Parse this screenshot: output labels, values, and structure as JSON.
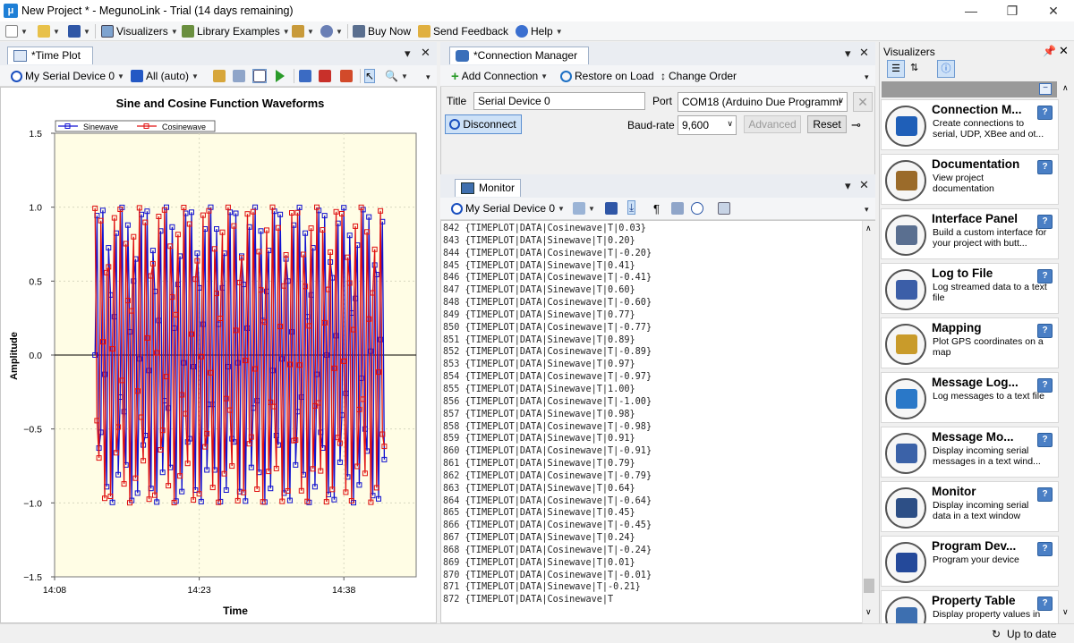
{
  "window": {
    "title": "New Project * - MegunoLink - Trial (14 days remaining)",
    "app_icon": "μ"
  },
  "toolbar": {
    "visualizers": "Visualizers",
    "library_examples": "Library Examples",
    "buy_now": "Buy Now",
    "send_feedback": "Send Feedback",
    "help": "Help"
  },
  "timeplot": {
    "tab": "*Time Plot",
    "device": "My Serial Device 0",
    "series_select": "All (auto)"
  },
  "chart_data": {
    "type": "line",
    "title": "Sine and Cosine Function Waveforms",
    "xlabel": "Time",
    "ylabel": "Amplitude",
    "ylim": [
      -1.5,
      1.5
    ],
    "yticks": [
      "1.5",
      "1.0",
      "0.5",
      "0.0",
      "−0.5",
      "−1.0",
      "−1.5"
    ],
    "ytick_values": [
      1.5,
      1.0,
      0.5,
      0.0,
      -0.5,
      -1.0,
      -1.5
    ],
    "xticks": [
      "14:08",
      "14:23",
      "14:38"
    ],
    "x_range_minutes": [
      0,
      37.5
    ],
    "xtick_minutes": [
      0,
      15,
      30
    ],
    "data_start_minute": 4.2,
    "data_end_minute": 34.2,
    "sample_step": 0.2,
    "grid": true,
    "legend_location": "top-left",
    "series": [
      {
        "name": "Sinewave",
        "color": "#1010d0",
        "function": "sin"
      },
      {
        "name": "Cosinewave",
        "color": "#e01010",
        "function": "cos"
      }
    ]
  },
  "connection": {
    "tab": "*Connection Manager",
    "add_connection": "Add Connection",
    "restore_on_load": "Restore on Load",
    "change_order": "Change Order",
    "title_label": "Title",
    "title_value": "Serial Device 0",
    "port_label": "Port",
    "port_value": "COM18 (Arduino Due Programmi",
    "disconnect": "Disconnect",
    "baud_label": "Baud-rate",
    "baud_value": "9,600",
    "advanced": "Advanced",
    "reset": "Reset"
  },
  "monitor": {
    "tab": "Monitor",
    "device": "My Serial Device 0",
    "lines": [
      [
        "842",
        "{TIMEPLOT|DATA|Cosinewave|T|0.03}"
      ],
      [
        "843",
        "{TIMEPLOT|DATA|Sinewave|T|0.20}"
      ],
      [
        "844",
        "{TIMEPLOT|DATA|Cosinewave|T|-0.20}"
      ],
      [
        "845",
        "{TIMEPLOT|DATA|Sinewave|T|0.41}"
      ],
      [
        "846",
        "{TIMEPLOT|DATA|Cosinewave|T|-0.41}"
      ],
      [
        "847",
        "{TIMEPLOT|DATA|Sinewave|T|0.60}"
      ],
      [
        "848",
        "{TIMEPLOT|DATA|Cosinewave|T|-0.60}"
      ],
      [
        "849",
        "{TIMEPLOT|DATA|Sinewave|T|0.77}"
      ],
      [
        "850",
        "{TIMEPLOT|DATA|Cosinewave|T|-0.77}"
      ],
      [
        "851",
        "{TIMEPLOT|DATA|Sinewave|T|0.89}"
      ],
      [
        "852",
        "{TIMEPLOT|DATA|Cosinewave|T|-0.89}"
      ],
      [
        "853",
        "{TIMEPLOT|DATA|Sinewave|T|0.97}"
      ],
      [
        "854",
        "{TIMEPLOT|DATA|Cosinewave|T|-0.97}"
      ],
      [
        "855",
        "{TIMEPLOT|DATA|Sinewave|T|1.00}"
      ],
      [
        "856",
        "{TIMEPLOT|DATA|Cosinewave|T|-1.00}"
      ],
      [
        "857",
        "{TIMEPLOT|DATA|Sinewave|T|0.98}"
      ],
      [
        "858",
        "{TIMEPLOT|DATA|Cosinewave|T|-0.98}"
      ],
      [
        "859",
        "{TIMEPLOT|DATA|Sinewave|T|0.91}"
      ],
      [
        "860",
        "{TIMEPLOT|DATA|Cosinewave|T|-0.91}"
      ],
      [
        "861",
        "{TIMEPLOT|DATA|Sinewave|T|0.79}"
      ],
      [
        "862",
        "{TIMEPLOT|DATA|Cosinewave|T|-0.79}"
      ],
      [
        "863",
        "{TIMEPLOT|DATA|Sinewave|T|0.64}"
      ],
      [
        "864",
        "{TIMEPLOT|DATA|Cosinewave|T|-0.64}"
      ],
      [
        "865",
        "{TIMEPLOT|DATA|Sinewave|T|0.45}"
      ],
      [
        "866",
        "{TIMEPLOT|DATA|Cosinewave|T|-0.45}"
      ],
      [
        "867",
        "{TIMEPLOT|DATA|Sinewave|T|0.24}"
      ],
      [
        "868",
        "{TIMEPLOT|DATA|Cosinewave|T|-0.24}"
      ],
      [
        "869",
        "{TIMEPLOT|DATA|Sinewave|T|0.01}"
      ],
      [
        "870",
        "{TIMEPLOT|DATA|Cosinewave|T|-0.01}"
      ],
      [
        "871",
        "{TIMEPLOT|DATA|Sinewave|T|-0.21}"
      ],
      [
        "872",
        "{TIMEPLOT|DATA|Cosinewave|T"
      ]
    ]
  },
  "visualizers": {
    "title": "Visualizers",
    "items": [
      {
        "title": "Connection M...",
        "desc": "Create connections to serial, UDP, XBee and ot...",
        "icon": "connection-icon"
      },
      {
        "title": "Documentation",
        "desc": "View project documentation",
        "icon": "documentation-icon"
      },
      {
        "title": "Interface Panel",
        "desc": "Build a custom interface for your project with butt...",
        "icon": "interface-panel-icon"
      },
      {
        "title": "Log to File",
        "desc": "Log streamed data to a text file",
        "icon": "log-file-icon"
      },
      {
        "title": "Mapping",
        "desc": "Plot GPS coordinates on a map",
        "icon": "mapping-icon"
      },
      {
        "title": "Message Log...",
        "desc": "Log messages to a text file",
        "icon": "message-log-icon"
      },
      {
        "title": "Message Mo...",
        "desc": "Display incoming serial messages in a text wind...",
        "icon": "message-monitor-icon"
      },
      {
        "title": "Monitor",
        "desc": "Display incoming serial data in a text window",
        "icon": "monitor-icon"
      },
      {
        "title": "Program Dev...",
        "desc": "Program your device",
        "icon": "program-device-icon"
      },
      {
        "title": "Property Table",
        "desc": "Display property values in",
        "icon": "property-table-icon"
      }
    ]
  },
  "status": {
    "update": "Up to date"
  }
}
